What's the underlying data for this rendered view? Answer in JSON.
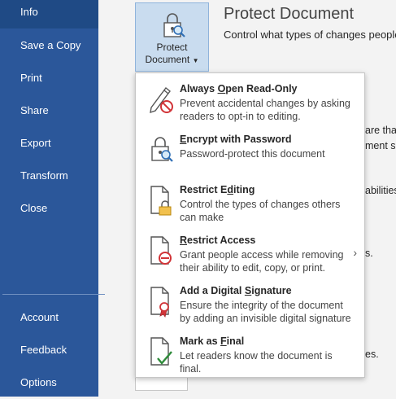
{
  "nav": {
    "items": [
      {
        "label": "Info",
        "active": true
      },
      {
        "label": "Save a Copy"
      },
      {
        "label": "Print"
      },
      {
        "label": "Share"
      },
      {
        "label": "Export"
      },
      {
        "label": "Transform"
      },
      {
        "label": "Close"
      }
    ],
    "bottom_items": [
      {
        "label": "Account"
      },
      {
        "label": "Feedback"
      },
      {
        "label": "Options"
      }
    ]
  },
  "protect_button": {
    "line1": "Protect",
    "line2": "Document",
    "icon": "lock-magnifier-icon"
  },
  "section": {
    "title": "Protect Document",
    "description": "Control what types of changes people ca"
  },
  "background_fragments": {
    "frag1": "are that",
    "frag2": "ment se",
    "frag3": "abilities",
    "frag4": "s.",
    "frag5": "es."
  },
  "menu": {
    "items": [
      {
        "title_parts": [
          "Always ",
          "O",
          "pen Read-Only"
        ],
        "description": "Prevent accidental changes by asking readers to opt-in to editing.",
        "icon": "pencil-no-icon"
      },
      {
        "title_parts": [
          "",
          "E",
          "ncrypt with Password"
        ],
        "description": "Password-protect this document",
        "icon": "lock-magnifier-icon"
      },
      {
        "title_parts": [
          "Restrict E",
          "d",
          "iting"
        ],
        "description": "Control the types of changes others can make",
        "icon": "document-lock-icon"
      },
      {
        "title_parts": [
          "",
          "R",
          "estrict Access"
        ],
        "description": "Grant people access while removing their ability to edit, copy, or print.",
        "icon": "document-no-icon",
        "has_submenu": true
      },
      {
        "title_parts": [
          "Add a Digital ",
          "S",
          "ignature"
        ],
        "description": "Ensure the integrity of the document by adding an invisible digital signature",
        "icon": "document-ribbon-icon"
      },
      {
        "title_parts": [
          "Mark as ",
          "F",
          "inal"
        ],
        "description": "Let readers know the document is final.",
        "icon": "document-check-icon"
      }
    ]
  },
  "colors": {
    "nav_bg": "#2b579a",
    "nav_active": "#1f4a85",
    "button_hover": "#c9dcef"
  }
}
